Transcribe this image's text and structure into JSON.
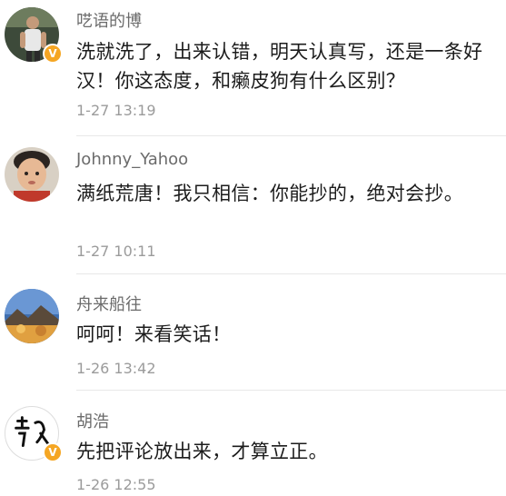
{
  "colors": {
    "username": "#6b6b6b",
    "body": "#1c1c1c",
    "timestamp": "#9b9b9b",
    "verified_badge": "#f5a623",
    "divider": "#e8e8e8"
  },
  "comments": [
    {
      "username": "呓语的博",
      "text": "洗就洗了，出来认错，明天认真写，还是一条好汉！你这态度，和癞皮狗有什么区别？",
      "time": "1-27 13:19",
      "verified": true,
      "verified_icon": "verified-v-icon"
    },
    {
      "username": "Johnny_Yahoo",
      "text": "满纸荒唐！我只相信：你能抄的，绝对会抄。",
      "time": "1-27 10:11",
      "verified": false
    },
    {
      "username": "舟来船往",
      "text": "呵呵！来看笑话！",
      "time": "1-26 13:42",
      "verified": false
    },
    {
      "username": "胡浩",
      "text": "先把评论放出来，才算立正。",
      "time": "1-26 12:55",
      "verified": true,
      "verified_icon": "verified-v-icon"
    }
  ]
}
